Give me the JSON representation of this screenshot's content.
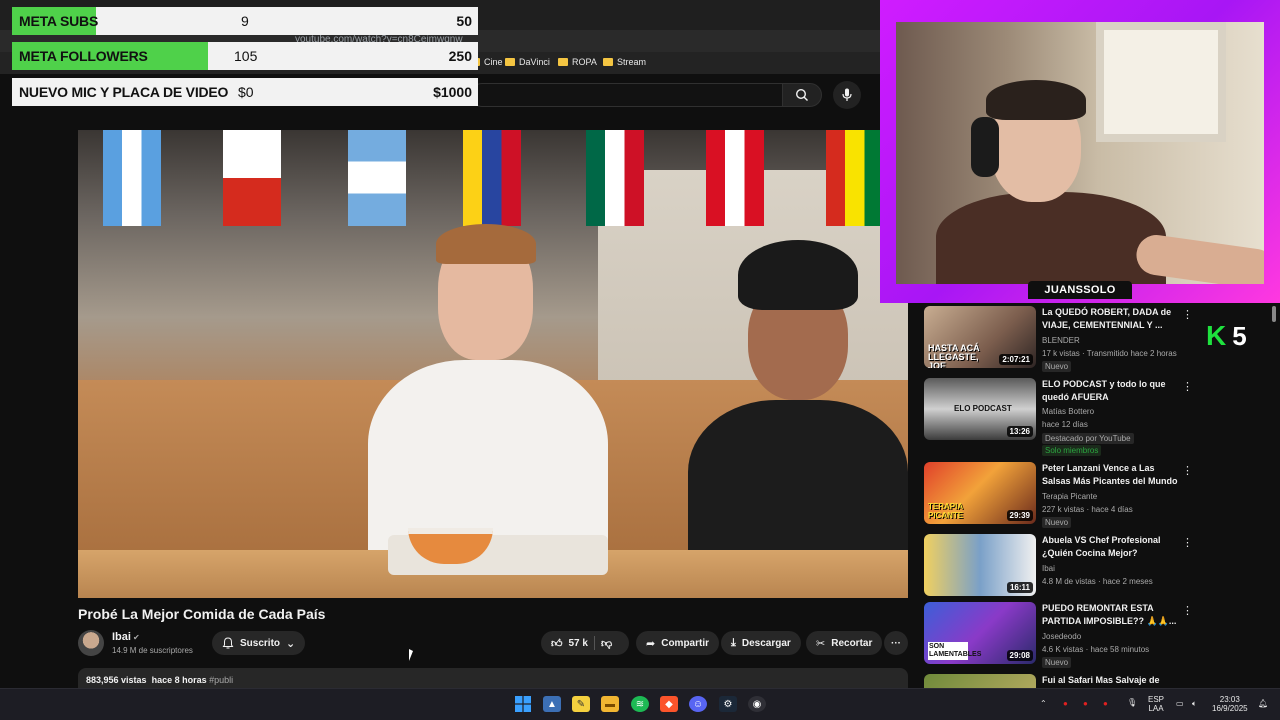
{
  "browser": {
    "url": "youtube.com/watch?v=cn8Ceimwqnw",
    "bookmarks": [
      "Cine",
      "DaVinci",
      "ROPA",
      "Stream"
    ]
  },
  "overlay": {
    "meta_subs": {
      "label": "META SUBS",
      "current": "9",
      "goal": "50",
      "progress": 0.18
    },
    "meta_followers": {
      "label": "META FOLLOWERS",
      "current": "105",
      "goal": "250",
      "progress": 0.42
    },
    "meta_mic": {
      "label": "NUEVO MIC Y PLACA DE VIDEO",
      "current": "$0",
      "goal": "$1000",
      "progress": 0.0
    }
  },
  "video": {
    "title": "Probé La Mejor Comida de Cada País",
    "channel": "Ibai",
    "subscribers": "14.9 M de suscriptores",
    "subscribe_label": "Suscrito",
    "likes": "57 k",
    "share_label": "Compartir",
    "download_label": "Descargar",
    "clip_label": "Recortar",
    "more_label": "···",
    "views": "883,956 vistas",
    "published": "hace 8 horas",
    "hashtag": "#publi"
  },
  "stream": {
    "streamer_name": "JUANSSOLO",
    "k_letter": "K",
    "k_count": "5"
  },
  "recommendations": [
    {
      "title": "La QUEDÓ ROBERT, DADA de VIAJE, CEMENTENNIAL Y ...",
      "channel": "BLENDER",
      "stats": "17 k vistas · Transmitido hace 2 horas",
      "badge": "Nuevo",
      "duration": "2:07:21",
      "thumb_text": "HASTA ACÁ LLEGASTE, JOE"
    },
    {
      "title": "ELO PODCAST y todo lo que quedó AFUERA",
      "channel": "Matías Bottero",
      "stats": "hace 12 días",
      "badge": "Destacado por YouTube",
      "members": "Solo miembros",
      "duration": "13:26",
      "thumb_text": "ELO PODCAST"
    },
    {
      "title": "Peter Lanzani Vence a Las Salsas Más Picantes del Mundo",
      "channel": "Terapia Picante",
      "stats": "227 k vistas · hace 4 días",
      "badge": "Nuevo",
      "duration": "29:39",
      "thumb_text": "TERAPIA PICANTE"
    },
    {
      "title": "Abuela VS Chef Profesional ¿Quién Cocina Mejor?",
      "channel": "Ibai",
      "stats": "4.8 M de vistas · hace 2 meses",
      "duration": "16:11"
    },
    {
      "title": "PUEDO REMONTAR ESTA PARTIDA IMPOSIBLE?? 🙏🙏...",
      "channel": "Josedeodo",
      "stats": "4.6 K vistas · hace 58 minutos",
      "badge": "Nuevo",
      "duration": "29:08",
      "thumb_text": "SON LAMENTABLES"
    },
    {
      "title": "Fui al Safari Mas Salvaje de"
    }
  ],
  "taskbar": {
    "lang_top": "ESP",
    "lang_bottom": "LAA",
    "time": "23:03",
    "date": "16/9/2025"
  },
  "colors": {
    "progress_green": "#4fd14a",
    "cam_border": "#b01cf5",
    "k_green": "#1ee23e"
  }
}
